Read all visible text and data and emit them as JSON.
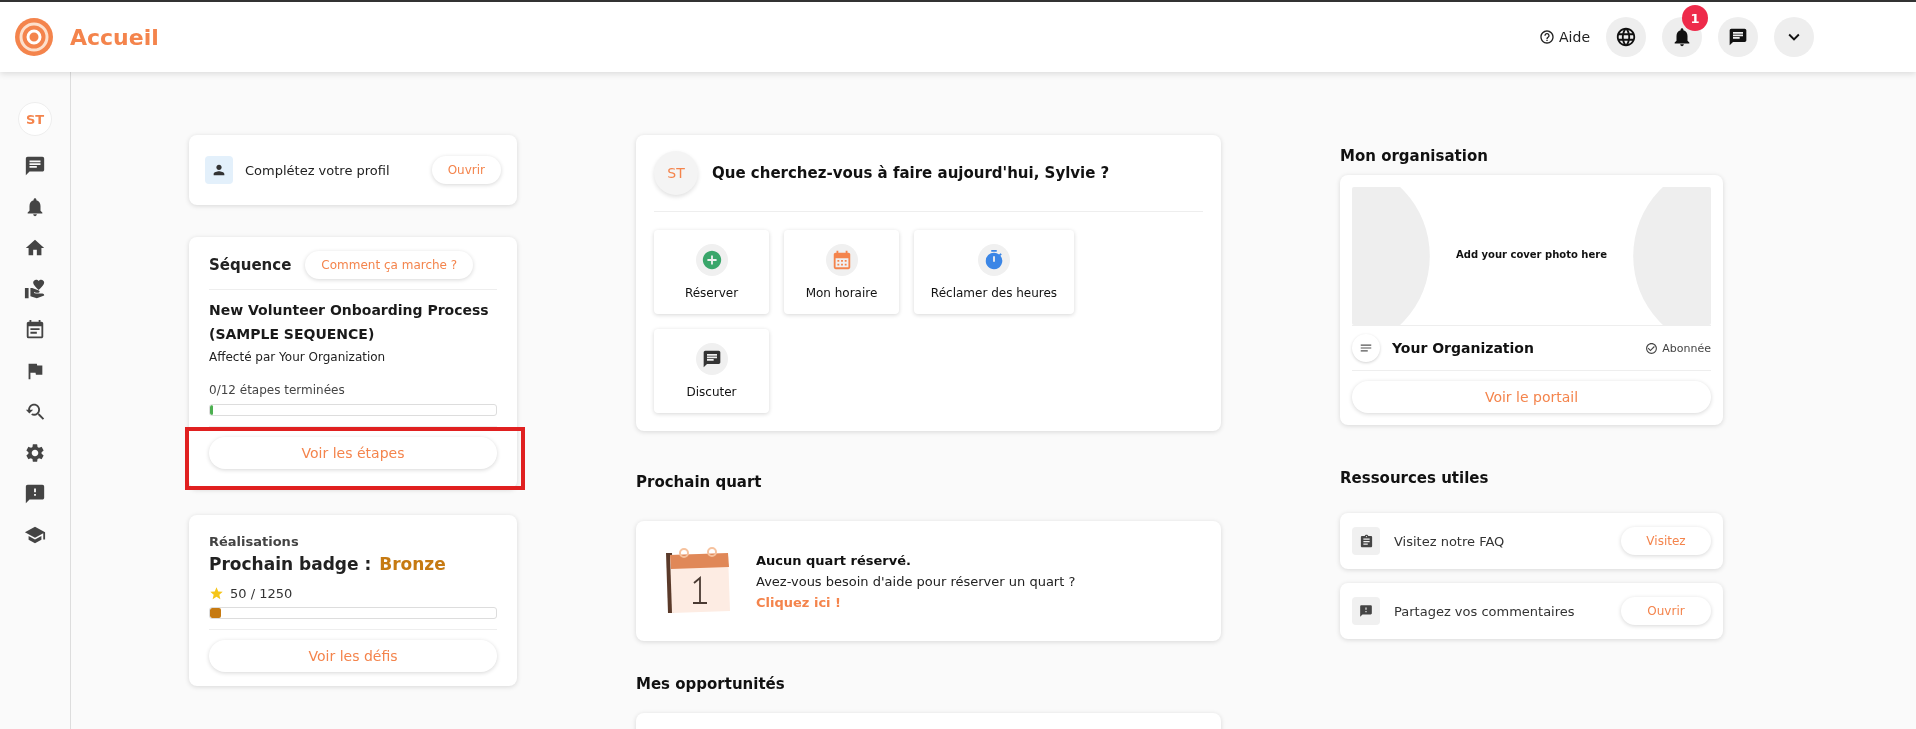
{
  "header": {
    "title": "Accueil",
    "help": "Aide",
    "notification_count": "1"
  },
  "sidebar": {
    "avatar": "ST"
  },
  "profile": {
    "label": "Complétez votre profil",
    "button": "Ouvrir"
  },
  "sequence": {
    "title": "Séquence",
    "help_button": "Comment ça marche ?",
    "name": "New Volunteer Onboarding Process (SAMPLE SEQUENCE)",
    "assigned_by": "Affecté par Your Organization",
    "progress_text": "0/12 étapes terminées",
    "level": 0.01,
    "button": "Voir les étapes"
  },
  "achievements": {
    "label": "Réalisations",
    "badge_label": "Prochain badge :",
    "badge": "Bronze",
    "points": "50 / 1250",
    "level": 0.04,
    "button": "Voir les défis"
  },
  "welcome": {
    "avatar": "ST",
    "question": "Que cherchez-vous à faire aujourd'hui, Sylvie ?",
    "actions": [
      {
        "label": "Réserver",
        "kind": "add"
      },
      {
        "label": "Mon horaire",
        "kind": "calendar"
      },
      {
        "label": "Réclamer des heures",
        "kind": "timer"
      },
      {
        "label": "Discuter",
        "kind": "chat"
      }
    ]
  },
  "next_shift": {
    "heading": "Prochain quart",
    "title": "Aucun quart réservé.",
    "text": "Avez-vous besoin d'aide pour réserver un quart ?",
    "link": "Cliquez ici !"
  },
  "opportunities": {
    "heading": "Mes opportunités"
  },
  "organization": {
    "heading": "Mon organisation",
    "cover_text": "Add your cover photo here",
    "name": "Your Organization",
    "status": "Abonnée",
    "button": "Voir le portail"
  },
  "resources": {
    "heading": "Ressources utiles",
    "items": [
      {
        "label": "Visitez notre FAQ",
        "button": "Visitez",
        "kind": "faq"
      },
      {
        "label": "Partagez vos commentaires",
        "button": "Ouvrir",
        "kind": "feedback"
      }
    ]
  }
}
